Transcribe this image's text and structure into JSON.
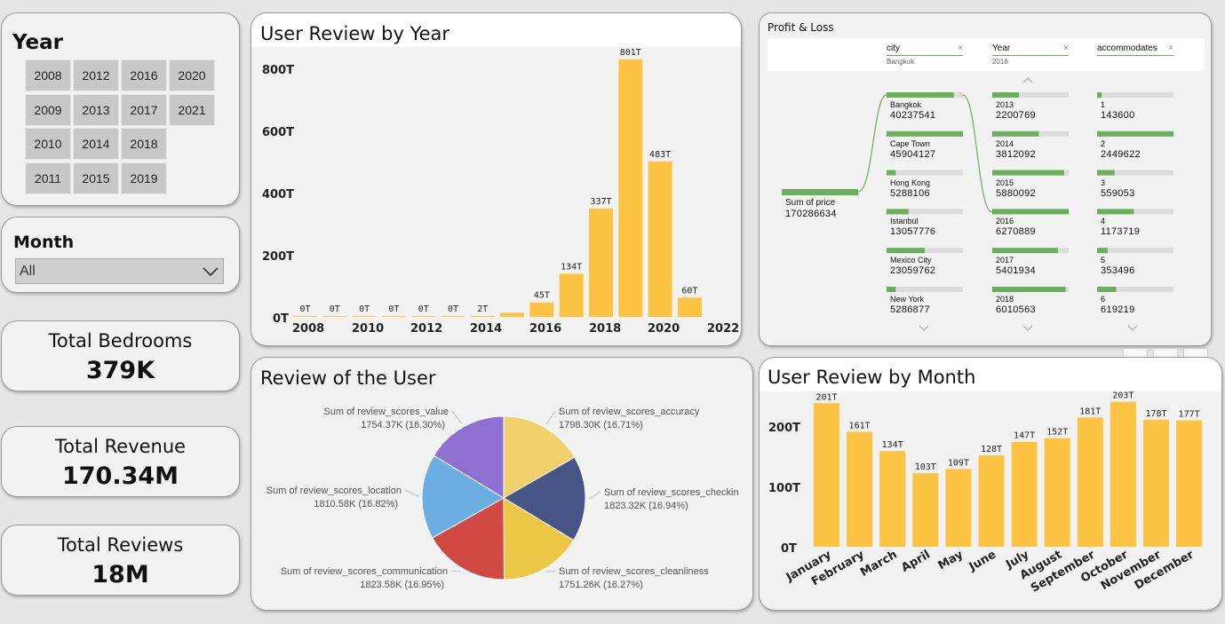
{
  "year_slicer": {
    "title": "Year",
    "years": [
      "2008",
      "2012",
      "2016",
      "2020",
      "2009",
      "2013",
      "2017",
      "2021",
      "2010",
      "2014",
      "2018",
      "2011",
      "2015",
      "2019"
    ]
  },
  "month_slicer": {
    "title": "Month",
    "selected": "All"
  },
  "kpis": {
    "bedrooms": {
      "label": "Total Bedrooms",
      "value": "379K"
    },
    "revenue": {
      "label": "Total Revenue",
      "value": "170.34M"
    },
    "reviews": {
      "label": "Total Reviews",
      "value": "18M"
    }
  },
  "review_by_year": {
    "title": "User Review by Year",
    "yticks": [
      "800T",
      "600T",
      "400T",
      "200T",
      "0T"
    ],
    "xticks": [
      "2008",
      "2010",
      "2012",
      "2014",
      "2016",
      "2018",
      "2020",
      "2022"
    ]
  },
  "review_of_user": {
    "title": "Review of the User"
  },
  "review_by_month": {
    "title": "User Review by Month",
    "yticks": [
      "200T",
      "100T",
      "0T"
    ]
  },
  "profit_loss": {
    "title": "Profit & Loss",
    "filters": [
      {
        "name": "city",
        "value": "Bangkok"
      },
      {
        "name": "Year",
        "value": "2016"
      },
      {
        "name": "accommodates",
        "value": ""
      }
    ],
    "root": {
      "label": "Sum of price",
      "value": "170286634"
    },
    "cities": [
      {
        "name": "Bangkok",
        "value": "40237541",
        "frac": 0.88
      },
      {
        "name": "Cape Town",
        "value": "45904127",
        "frac": 1.0
      },
      {
        "name": "Hong Kong",
        "value": "5288106",
        "frac": 0.12
      },
      {
        "name": "Istanbul",
        "value": "13057776",
        "frac": 0.29
      },
      {
        "name": "Mexico City",
        "value": "23059762",
        "frac": 0.5
      },
      {
        "name": "New York",
        "value": "5286877",
        "frac": 0.12
      }
    ],
    "years": [
      {
        "name": "2013",
        "value": "2200769",
        "frac": 0.35
      },
      {
        "name": "2014",
        "value": "3812092",
        "frac": 0.61
      },
      {
        "name": "2015",
        "value": "5880092",
        "frac": 0.94
      },
      {
        "name": "2016",
        "value": "6270889",
        "frac": 1.0
      },
      {
        "name": "2017",
        "value": "5401934",
        "frac": 0.86
      },
      {
        "name": "2018",
        "value": "6010563",
        "frac": 0.96
      }
    ],
    "accommodates": [
      {
        "name": "1",
        "value": "143600",
        "frac": 0.06
      },
      {
        "name": "2",
        "value": "2449622",
        "frac": 1.0
      },
      {
        "name": "3",
        "value": "559053",
        "frac": 0.23
      },
      {
        "name": "4",
        "value": "1173719",
        "frac": 0.48
      },
      {
        "name": "5",
        "value": "353496",
        "frac": 0.14
      },
      {
        "name": "6",
        "value": "619219",
        "frac": 0.25
      }
    ]
  },
  "colors": {
    "bar": "#fdc444",
    "pl_bar": "#6aaf5b",
    "pl_track": "#dcdcdc"
  },
  "chart_data": [
    {
      "type": "bar",
      "title": "User Review by Year",
      "categories": [
        "2008",
        "2009",
        "2010",
        "2011",
        "2012",
        "2013",
        "2014",
        "2015",
        "2016",
        "2017",
        "2018",
        "2019",
        "2020",
        "2021"
      ],
      "values": [
        0,
        0,
        0,
        0,
        0,
        0,
        2,
        13,
        45,
        134,
        337,
        801,
        483,
        60
      ],
      "labels": [
        "0T",
        "0T",
        "0T",
        "0T",
        "0T",
        "0T",
        "2T",
        "",
        "45T",
        "134T",
        "337T",
        "801T",
        "483T",
        "60T"
      ],
      "ylim": [
        0,
        850
      ]
    },
    {
      "type": "pie",
      "title": "Review of the User",
      "slices": [
        {
          "label": "Sum of review_scores_accuracy",
          "value": "1798.30K (16.71%)",
          "pct": 16.71,
          "color": "#f0d06a"
        },
        {
          "label": "Sum of review_scores_checkin",
          "value": "1823.32K (16.94%)",
          "pct": 16.94,
          "color": "#475486"
        },
        {
          "label": "Sum of review_scores_cleanliness",
          "value": "1751.26K (16.27%)",
          "pct": 16.27,
          "color": "#ecc745"
        },
        {
          "label": "Sum of review_scores_communication",
          "value": "1823.58K (16.95%)",
          "pct": 16.95,
          "color": "#d04a43"
        },
        {
          "label": "Sum of review_scores_location",
          "value": "1810.58K (16.82%)",
          "pct": 16.82,
          "color": "#6aaee2"
        },
        {
          "label": "Sum of review_scores_value",
          "value": "1754.37K (16.30%)",
          "pct": 16.3,
          "color": "#8e6fd2"
        }
      ]
    },
    {
      "type": "bar",
      "title": "User Review by Month",
      "categories": [
        "January",
        "February",
        "March",
        "April",
        "May",
        "June",
        "July",
        "August",
        "September",
        "October",
        "November",
        "December"
      ],
      "values": [
        201,
        161,
        134,
        103,
        109,
        128,
        147,
        152,
        181,
        203,
        178,
        177
      ],
      "labels": [
        "201T",
        "161T",
        "134T",
        "103T",
        "109T",
        "128T",
        "147T",
        "152T",
        "181T",
        "203T",
        "178T",
        "177T"
      ],
      "ylim": [
        0,
        215
      ]
    }
  ]
}
